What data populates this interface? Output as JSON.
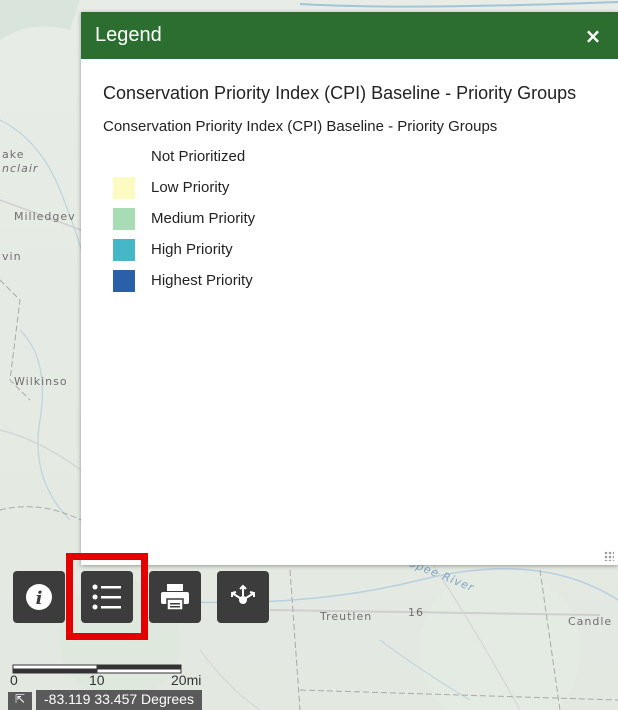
{
  "legend": {
    "title": "Legend",
    "close_label": "×",
    "layer_title": "Conservation Priority Index (CPI) Baseline - Priority Groups",
    "layer_subtitle": "Conservation Priority Index (CPI) Baseline - Priority Groups",
    "items": [
      {
        "label": "Not Prioritized",
        "color": "#ffffff"
      },
      {
        "label": "Low Priority",
        "color": "#fdfbc2"
      },
      {
        "label": "Medium Priority",
        "color": "#a8dcb5"
      },
      {
        "label": "High Priority",
        "color": "#45b7c9"
      },
      {
        "label": "Highest Priority",
        "color": "#2a60aa"
      }
    ]
  },
  "toolbar": {
    "buttons": [
      {
        "name": "about-button",
        "icon": "info-icon"
      },
      {
        "name": "legend-button",
        "icon": "list-icon",
        "active": true
      },
      {
        "name": "print-button",
        "icon": "printer-icon"
      },
      {
        "name": "share-button",
        "icon": "share-icon"
      }
    ]
  },
  "map": {
    "labels": {
      "lake": "ake",
      "sinclair": "nclair",
      "milledgeville": "Milledgev",
      "vin": "vin",
      "wilkinson": "Wilkinso",
      "treutlen": "Treutlen",
      "candler": "Candle",
      "river": "hoopee River",
      "route": "16"
    }
  },
  "scalebar": {
    "labels": [
      "0",
      "10",
      "20mi"
    ]
  },
  "coordinates": {
    "text": "-83.119 33.457 Degrees",
    "expand_icon": "expand-icon"
  },
  "colors": {
    "header": "#2c6e2f",
    "highlight": "#e50000",
    "toolbar": "#3c3c3c"
  }
}
